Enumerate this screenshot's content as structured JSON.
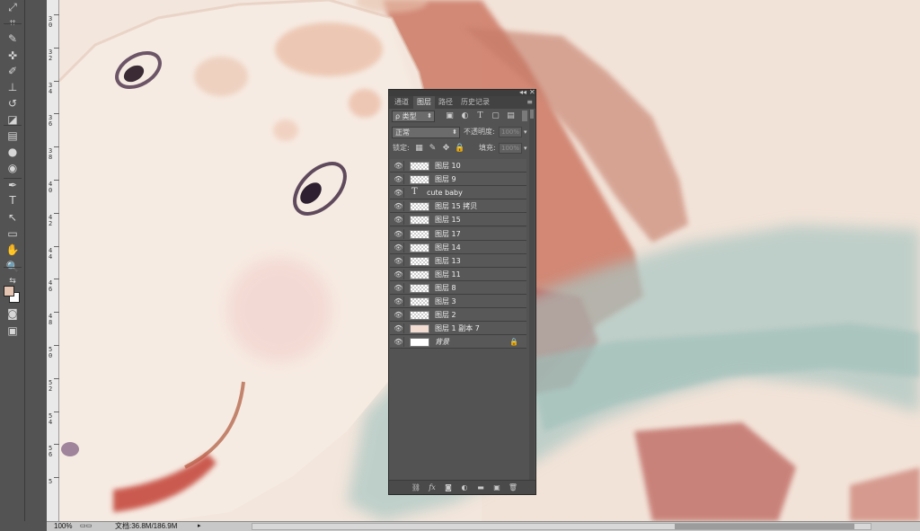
{
  "tools": [
    {
      "icon": "move-icon",
      "glyph": "⤢"
    },
    {
      "icon": "crop-icon",
      "glyph": "⌗"
    },
    {
      "icon": "eyedropper-icon",
      "glyph": "✎"
    },
    {
      "icon": "healing-brush-icon",
      "glyph": "✜"
    },
    {
      "icon": "brush-icon",
      "glyph": "✐"
    },
    {
      "icon": "clone-stamp-icon",
      "glyph": "⊥"
    },
    {
      "icon": "history-brush-icon",
      "glyph": "↺"
    },
    {
      "icon": "eraser-icon",
      "glyph": "◪"
    },
    {
      "icon": "gradient-icon",
      "glyph": "▤"
    },
    {
      "icon": "blur-icon",
      "glyph": "●"
    },
    {
      "icon": "dodge-icon",
      "glyph": "◉"
    },
    {
      "icon": "pen-icon",
      "glyph": "✒"
    },
    {
      "icon": "type-icon",
      "glyph": "T"
    },
    {
      "icon": "path-selection-icon",
      "glyph": "↖"
    },
    {
      "icon": "rectangle-shape-icon",
      "glyph": "▭"
    },
    {
      "icon": "hand-icon",
      "glyph": "✋"
    },
    {
      "icon": "zoom-icon",
      "glyph": "🔍"
    }
  ],
  "ruler": {
    "labels": [
      "3\n0",
      "3\n2",
      "3\n4",
      "3\n6",
      "3\n8",
      "4\n0",
      "4\n2",
      "4\n4",
      "4\n6",
      "4\n8",
      "5\n0",
      "5\n2",
      "5\n4",
      "5\n6",
      "5"
    ]
  },
  "panel": {
    "tabs": [
      "通道",
      "图层",
      "路径",
      "历史记录"
    ],
    "active_tab": 1,
    "filter_kind": "ρ 类型",
    "blend_mode": "正常",
    "opacity_label": "不透明度:",
    "opacity_value": "100%",
    "lock_label": "锁定:",
    "fill_label": "填充:",
    "fill_value": "100%",
    "layers": [
      {
        "name": "图层 10",
        "kind": "pixel"
      },
      {
        "name": "图层 9",
        "kind": "pixel"
      },
      {
        "name": "cute baby",
        "kind": "text"
      },
      {
        "name": "图层 15 拷贝",
        "kind": "pixel"
      },
      {
        "name": "图层 15",
        "kind": "pixel"
      },
      {
        "name": "图层 17",
        "kind": "pixel"
      },
      {
        "name": "图层 14",
        "kind": "pixel"
      },
      {
        "name": "图层 13",
        "kind": "pixel"
      },
      {
        "name": "图层 11",
        "kind": "pixel"
      },
      {
        "name": "图层 8",
        "kind": "pixel"
      },
      {
        "name": "图层 3",
        "kind": "pixel"
      },
      {
        "name": "图层 2",
        "kind": "pixel"
      },
      {
        "name": "图层 1 副本 7",
        "kind": "filled"
      },
      {
        "name": "背景",
        "kind": "background",
        "locked": true
      }
    ]
  },
  "status": {
    "zoom": "100%",
    "doc_info": "文档:36.8M/186.9M"
  },
  "colors": {
    "foreground": "#e6c4b2",
    "background": "#ffffff",
    "ui_dark": "#535353",
    "panel_bg": "#535353"
  }
}
